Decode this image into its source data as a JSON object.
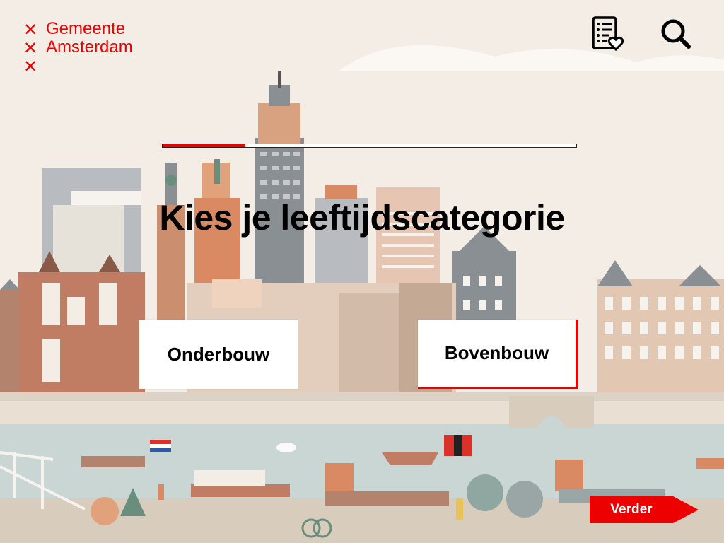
{
  "header": {
    "logo_line1": "Gemeente",
    "logo_line2": "Amsterdam",
    "logo_cross": "✕",
    "list_icon": "checklist-heart-icon",
    "search_icon": "search-icon"
  },
  "progress": {
    "value": 0.2
  },
  "main": {
    "title": "Kies je leeftijdscategorie",
    "options": [
      {
        "label": "Onderbouw",
        "selected": false
      },
      {
        "label": "Bovenbouw",
        "selected": true
      }
    ]
  },
  "footer": {
    "next_label": "Verder"
  },
  "colors": {
    "accent": "#ec0000",
    "background": "#f3ede6",
    "water": "#c9d6d3"
  }
}
